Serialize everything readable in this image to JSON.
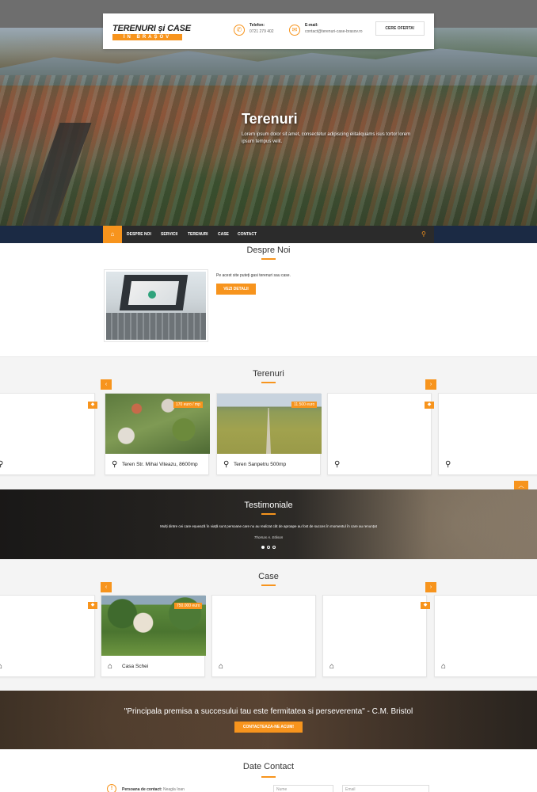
{
  "header": {
    "logo_line1": "TERENURI și CASE",
    "logo_line2": "ÎN BRAȘOV",
    "phone_label": "Telefon:",
    "phone_value": "0721 279 402",
    "email_label": "E-mail:",
    "email_value": "contact@terenuri-case-brasov.ro",
    "cta_label": "CERE OFERTA!"
  },
  "hero": {
    "title": "Terenuri",
    "text": "Lorem ipsum dolor sit amet, consectetur adipiscing elitaliquams isus tortor lorem ipsum tempus velit."
  },
  "nav": {
    "items": [
      "DESPRE NOI",
      "SERVICII",
      "TERENURI",
      "CASE",
      "CONTACT"
    ]
  },
  "despre": {
    "title": "Despre Noi",
    "text": "Pe acest site puteți gasi terenuri sau case.",
    "button": "VEZI DETALII"
  },
  "terenuri": {
    "title": "Terenuri",
    "cards": [
      {
        "title": "Teren Str. Mihai Viteazu, 8600mp",
        "price": "170 euro / mp"
      },
      {
        "title": "Teren Sanpetru 500mp",
        "price": "11.500 euro"
      }
    ]
  },
  "testimoniale": {
    "title": "Testimoniale",
    "text": "Mulți dintre cei care eșuează în viață sunt persoane care nu au realizat cât de aproape au fost de succes în momentul în care au renunțat",
    "author": "Thomas A. Edison"
  },
  "case": {
    "title": "Case",
    "cards": [
      {
        "title": "Casa Schei",
        "price": "750.000 euro"
      }
    ]
  },
  "quote": {
    "text": "\"Principala premisa a succesului tau este fermitatea si perseverenta\" - C.M. Bristol",
    "button": "CONTACTEAZA-NE ACUM!"
  },
  "contact": {
    "title": "Date Contact",
    "person_label": "Persoana de contact:",
    "person_value": "Neagla Ioan",
    "name_placeholder": "Nume",
    "email_placeholder": "Email"
  },
  "colors": {
    "accent": "#f7941d",
    "nav": "#1b2a44"
  }
}
